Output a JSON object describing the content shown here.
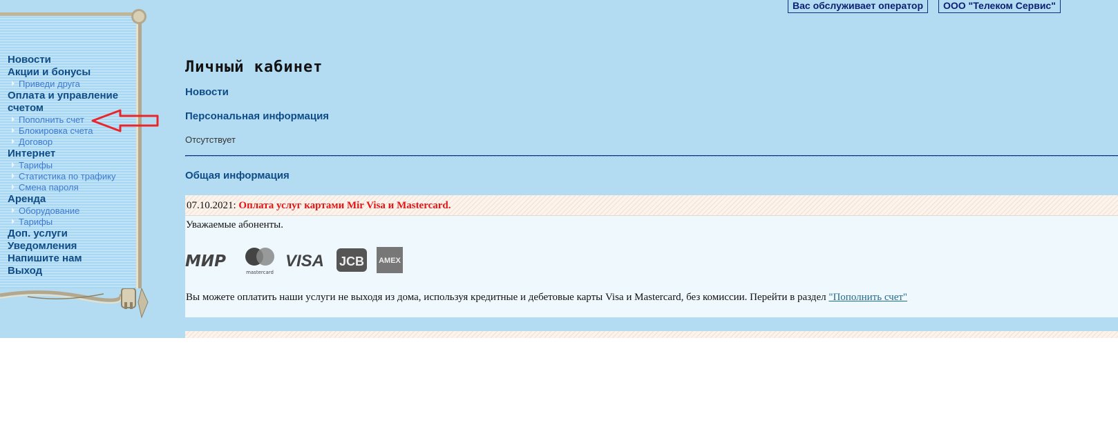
{
  "header": {
    "operator_label": "Вас обслуживает оператор",
    "operator_name": "ООО \"Телеком Сервис\""
  },
  "sidebar": {
    "items": [
      {
        "label": "Новости",
        "type": "main"
      },
      {
        "label": "Акции и бонусы",
        "type": "main"
      },
      {
        "label": "Приведи друга",
        "type": "sub"
      },
      {
        "label": "Оплата и управление счетом",
        "type": "main"
      },
      {
        "label": "Пополнить счет",
        "type": "sub"
      },
      {
        "label": "Блокировка счета",
        "type": "sub"
      },
      {
        "label": "Договор",
        "type": "sub"
      },
      {
        "label": "Интернет",
        "type": "main"
      },
      {
        "label": "Тарифы",
        "type": "sub"
      },
      {
        "label": "Статистика по трафику",
        "type": "sub"
      },
      {
        "label": "Смена пароля",
        "type": "sub"
      },
      {
        "label": "Аренда",
        "type": "main"
      },
      {
        "label": "Оборудование",
        "type": "sub"
      },
      {
        "label": "Тарифы",
        "type": "sub"
      },
      {
        "label": "Доп. услуги",
        "type": "main"
      },
      {
        "label": "Уведомления",
        "type": "main"
      },
      {
        "label": "Напишите нам",
        "type": "main"
      },
      {
        "label": "Выход",
        "type": "main"
      }
    ]
  },
  "main": {
    "title": "Личный кабинет",
    "news_heading": "Новости",
    "personal_heading": "Персональная информация",
    "personal_value": "Отсутствует",
    "general_heading": "Общая информация",
    "news": [
      {
        "date": "07.10.2021:",
        "title": "Оплата услуг картами Mir Visa и Mastercard.",
        "greeting": "Уважаемые абоненты.",
        "cards": [
          "МИР",
          "mastercard",
          "VISA",
          "JCB",
          "AMEX"
        ],
        "text": "Вы можете оплатить наши услуги не выходя из дома, используя кредитные и дебетовые карты Visa и Mastercard, без комиссии. Перейти в раздел ",
        "link": "\"Пополнить счет\""
      }
    ]
  },
  "colors": {
    "background": "#b3dcf2",
    "nav_main": "#0f4c86",
    "nav_sub": "#3f7ad1",
    "news_title": "#e61515",
    "arrow": "#e8262b"
  }
}
